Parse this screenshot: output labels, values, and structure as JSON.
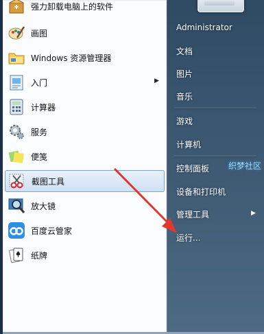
{
  "left_items": [
    {
      "label": "强力卸载电脑上的软件",
      "icon": "uninstall-box-icon"
    },
    {
      "label": "画图",
      "icon": "paint-palette-icon"
    },
    {
      "label": "Windows 资源管理器",
      "icon": "explorer-folder-icon"
    },
    {
      "label": "入门",
      "icon": "getting-started-icon",
      "has_submenu": true
    },
    {
      "label": "计算器",
      "icon": "calculator-icon"
    },
    {
      "label": "服务",
      "icon": "services-gear-icon"
    },
    {
      "label": "便笺",
      "icon": "sticky-notes-icon"
    },
    {
      "label": "截图工具",
      "icon": "snipping-scissors-icon",
      "selected": true
    },
    {
      "label": "放大镜",
      "icon": "magnifier-icon"
    },
    {
      "label": "百度云管家",
      "icon": "baidu-cloud-icon"
    },
    {
      "label": "纸牌",
      "icon": "solitaire-cards-icon"
    }
  ],
  "right_items": [
    {
      "label": "Administrator"
    },
    {
      "label": "文档"
    },
    {
      "label": "图片"
    },
    {
      "label": "音乐"
    },
    {
      "label": "游戏"
    },
    {
      "label": "计算机"
    },
    {
      "label": "控制面板"
    },
    {
      "label": "设备和打印机"
    },
    {
      "label": "管理工具",
      "has_submenu": true
    },
    {
      "label": "运行..."
    }
  ],
  "watermark": "织梦社区",
  "arrow_color": "#e0382c",
  "selected_highlight": "#cfe0f5"
}
